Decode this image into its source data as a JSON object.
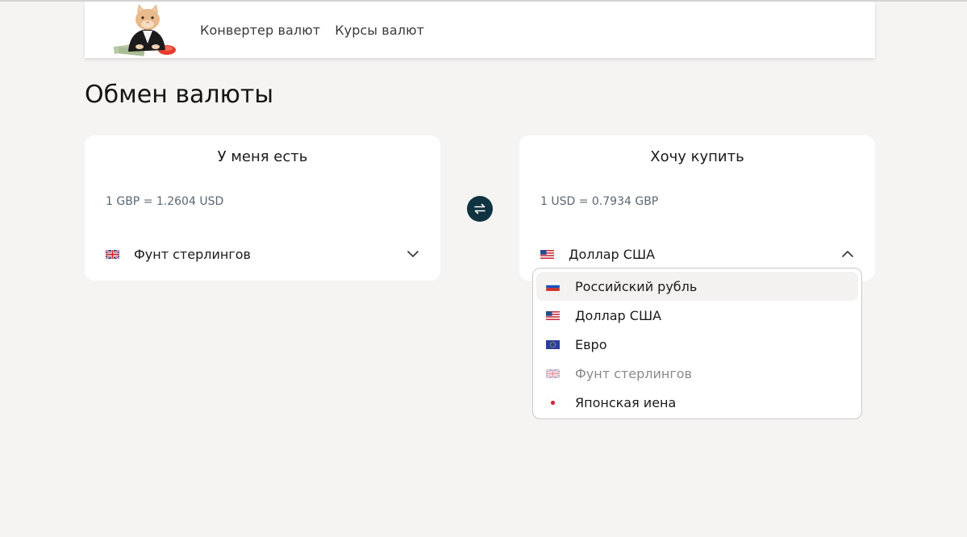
{
  "header": {
    "nav": [
      "Конвертер валют",
      "Курсы валют"
    ]
  },
  "page": {
    "title": "Обмен валюты"
  },
  "from_card": {
    "title": "У меня есть",
    "rate": "1 GBP = 1.2604 USD",
    "selected": "Фунт стерлингов"
  },
  "to_card": {
    "title": "Хочу купить",
    "rate": "1 USD = 0.7934 GBP",
    "selected": "Доллар США"
  },
  "dropdown": {
    "options": [
      {
        "label": "Российский рубль",
        "flag": "ru-flag-icon",
        "highlighted": true
      },
      {
        "label": "Доллар США",
        "flag": "us-flag-icon"
      },
      {
        "label": "Евро",
        "flag": "eu-flag-icon"
      },
      {
        "label": "Фунт стерлингов",
        "flag": "gb-flag-icon",
        "disabled": true
      },
      {
        "label": "Японская иена",
        "flag": "jp-flag-icon"
      }
    ]
  },
  "colors": {
    "background": "#f5f4f2",
    "swap_button": "#0f3340",
    "rate_text": "#5b6670"
  }
}
